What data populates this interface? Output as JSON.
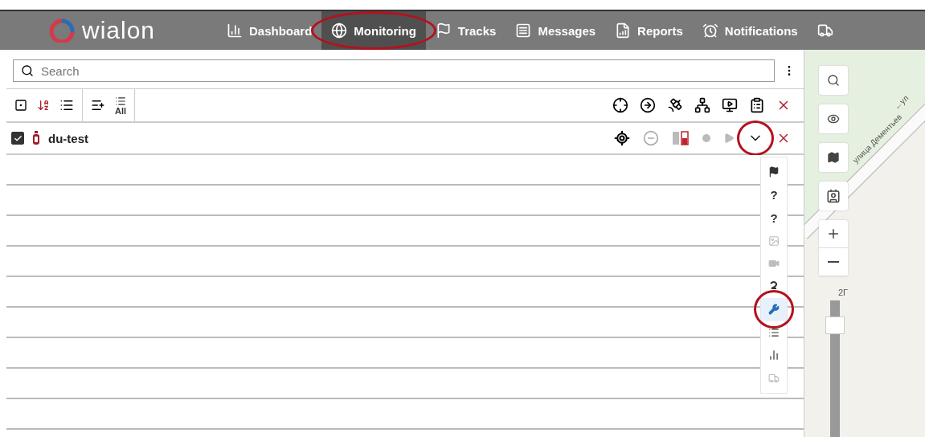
{
  "header": {
    "logo": "wialon",
    "nav": [
      {
        "label": "Dashboard",
        "selected": false,
        "annotated": false
      },
      {
        "label": "Monitoring",
        "selected": true,
        "annotated": true
      },
      {
        "label": "Tracks",
        "selected": false,
        "annotated": false
      },
      {
        "label": "Messages",
        "selected": false,
        "annotated": false
      },
      {
        "label": "Reports",
        "selected": false,
        "annotated": false
      },
      {
        "label": "Notifications",
        "selected": false,
        "annotated": false
      }
    ]
  },
  "search": {
    "placeholder": "Search"
  },
  "toolbar": {
    "all_label": "All"
  },
  "units": [
    {
      "name": "du-test",
      "checked": true,
      "menu_open": true
    }
  ],
  "unit_menu": [
    {
      "kind": "flag",
      "disabled": false,
      "selected": false
    },
    {
      "kind": "text",
      "text": "?",
      "disabled": false,
      "selected": false
    },
    {
      "kind": "text",
      "text": "?",
      "disabled": false,
      "selected": false
    },
    {
      "kind": "image",
      "disabled": true,
      "selected": false
    },
    {
      "kind": "video",
      "disabled": true,
      "selected": false
    },
    {
      "kind": "squiggle",
      "disabled": false,
      "selected": false
    },
    {
      "kind": "wrench",
      "disabled": false,
      "selected": true
    },
    {
      "kind": "list",
      "disabled": false,
      "selected": false
    },
    {
      "kind": "chart",
      "disabled": false,
      "selected": false
    },
    {
      "kind": "trailer",
      "disabled": true,
      "selected": false
    }
  ],
  "map": {
    "labels": [
      "←ул",
      "улица Дементьев"
    ],
    "zoom_label": "2Г",
    "zoom": {
      "level": 0.88
    }
  }
}
